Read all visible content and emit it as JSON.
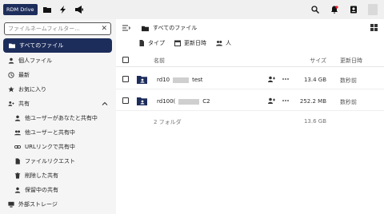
{
  "header": {
    "logo_text": "RDM Drive",
    "icons": [
      "folder-icon",
      "activity-icon",
      "announcement-icon",
      "search-icon",
      "notifications-icon",
      "contacts-icon",
      "avatar"
    ]
  },
  "sidebar": {
    "filter_placeholder": "ファイルネームフィルター...",
    "active_item": "すべてのファイル",
    "items": [
      {
        "label": "個人ファイル",
        "icon": "person-icon"
      },
      {
        "label": "最新",
        "icon": "history-icon"
      },
      {
        "label": "お気に入り",
        "icon": "star-icon"
      },
      {
        "label": "共有",
        "icon": "share-icon"
      },
      {
        "label": "他ユーザーがあなたと共有中",
        "icon": "shared-with-you-icon"
      },
      {
        "label": "他ユーザーと共有中",
        "icon": "shared-with-others-icon"
      },
      {
        "label": "URLリンクで共有中",
        "icon": "link-icon"
      },
      {
        "label": "ファイルリクエスト",
        "icon": "file-request-icon"
      },
      {
        "label": "削除した共有",
        "icon": "deleted-share-icon"
      },
      {
        "label": "保留中の共有",
        "icon": "pending-share-icon"
      },
      {
        "label": "外部ストレージ",
        "icon": "external-storage-icon"
      }
    ]
  },
  "main": {
    "breadcrumb": "すべてのファイル",
    "sort": {
      "type": "タイプ",
      "modified": "更新日時",
      "person": "人"
    },
    "columns": {
      "name": "名前",
      "size": "サイズ",
      "modified": "更新日時"
    },
    "rows": [
      {
        "name_prefix": "rd10",
        "name_suffix": "test",
        "size": "13.4 GB",
        "modified": "数秒前"
      },
      {
        "name_prefix": "rd100(",
        "name_suffix": "C2",
        "size": "252.2 MB",
        "modified": "数秒前"
      }
    ],
    "summary": {
      "folders": "2 フォルダ",
      "total_size": "13.6 GB"
    }
  },
  "colors": {
    "accent": "#1d2d5b",
    "sidebar_bg": "#f5f5f5",
    "header_bg": "#f0f0f0"
  }
}
